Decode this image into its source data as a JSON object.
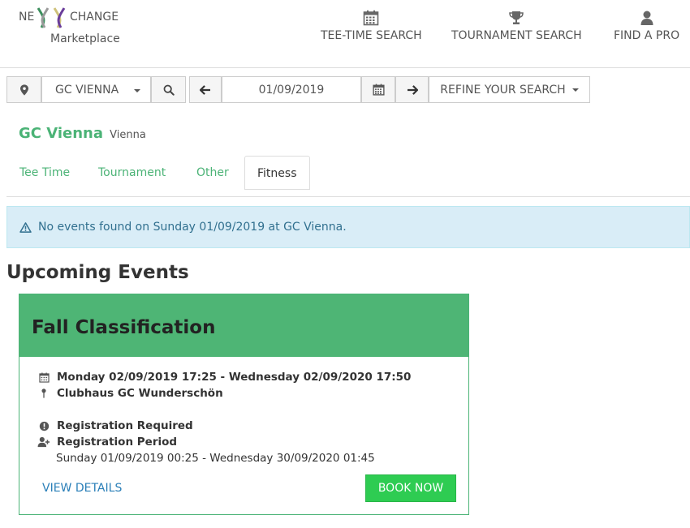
{
  "header": {
    "logo_prefix": "NE",
    "logo_suffix": "CHANGE",
    "logo_sub": "Marketplace",
    "nav": [
      {
        "label": "TEE-TIME SEARCH",
        "icon": "calendar-icon"
      },
      {
        "label": "TOURNAMENT SEARCH",
        "icon": "trophy-icon"
      },
      {
        "label": "FIND A PRO",
        "icon": "user-icon"
      }
    ]
  },
  "search": {
    "location_icon": "map-marker-icon",
    "club_value": "GC VIENNA",
    "search_icon": "search-icon",
    "prev_icon": "arrow-left-icon",
    "date_value": "01/09/2019",
    "calendar_icon": "calendar-icon",
    "next_icon": "arrow-right-icon",
    "refine_label": "REFINE YOUR SEARCH"
  },
  "club": {
    "name": "GC Vienna",
    "city": "Vienna"
  },
  "tabs": [
    {
      "label": "Tee Time",
      "active": false
    },
    {
      "label": "Tournament",
      "active": false
    },
    {
      "label": "Other",
      "active": false
    },
    {
      "label": "Fitness",
      "active": true
    }
  ],
  "alert": {
    "icon": "warning-icon",
    "text": "No events found on Sunday 01/09/2019 at GC Vienna."
  },
  "upcoming": {
    "title": "Upcoming Events",
    "event": {
      "name": "Fall Classification",
      "datetime": "Monday 02/09/2019 17:25 - Wednesday 02/09/2020 17:50",
      "location": "Clubhaus GC Wunderschön",
      "registration_required": "Registration Required",
      "registration_period_label": "Registration Period",
      "registration_period": "Sunday 01/09/2019 00:25 - Wednesday 30/09/2020 01:45",
      "view_details": "VIEW DETAILS",
      "book_now": "BOOK NOW"
    }
  },
  "colors": {
    "brand_green": "#4bb376",
    "card_header": "#4eb575",
    "book_button": "#2ecc52",
    "alert_bg": "#d9edf7",
    "alert_text": "#31708f",
    "link_blue": "#2a7fb8"
  }
}
